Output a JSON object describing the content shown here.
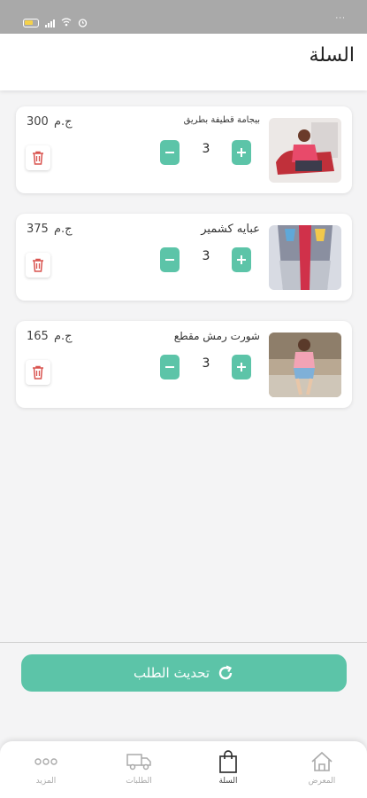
{
  "status_bar": {
    "left_icons": [
      "battery-icon",
      "signal-icon",
      "wifi-icon",
      "alarm-icon"
    ],
    "right_text": "···"
  },
  "header": {
    "title": "السلة"
  },
  "cart": {
    "currency": "ج.م",
    "items": [
      {
        "name": "بيجامة قطيفة بطريق",
        "price": "300",
        "quantity": "3",
        "thumb_icon": "product-pajama-image"
      },
      {
        "name": "عبايه كشمير",
        "price": "375",
        "quantity": "3",
        "thumb_icon": "product-abaya-image"
      },
      {
        "name": "شورت رمش مقطع",
        "price": "165",
        "quantity": "3",
        "thumb_icon": "product-shorts-image"
      }
    ]
  },
  "update_button": {
    "label": "تحديث الطلب",
    "icon": "refresh-icon"
  },
  "bottom_nav": {
    "items": [
      {
        "label": "المعرض",
        "icon": "home-icon"
      },
      {
        "label": "السلة",
        "icon": "shopping-bag-icon"
      },
      {
        "label": "الطلبات",
        "icon": "truck-icon"
      },
      {
        "label": "المزيد",
        "icon": "more-dots-icon"
      }
    ],
    "active_index": 1
  },
  "colors": {
    "accent": "#5cc4a8",
    "delete": "#d9534f",
    "status_bar": "#a9a9a9"
  }
}
